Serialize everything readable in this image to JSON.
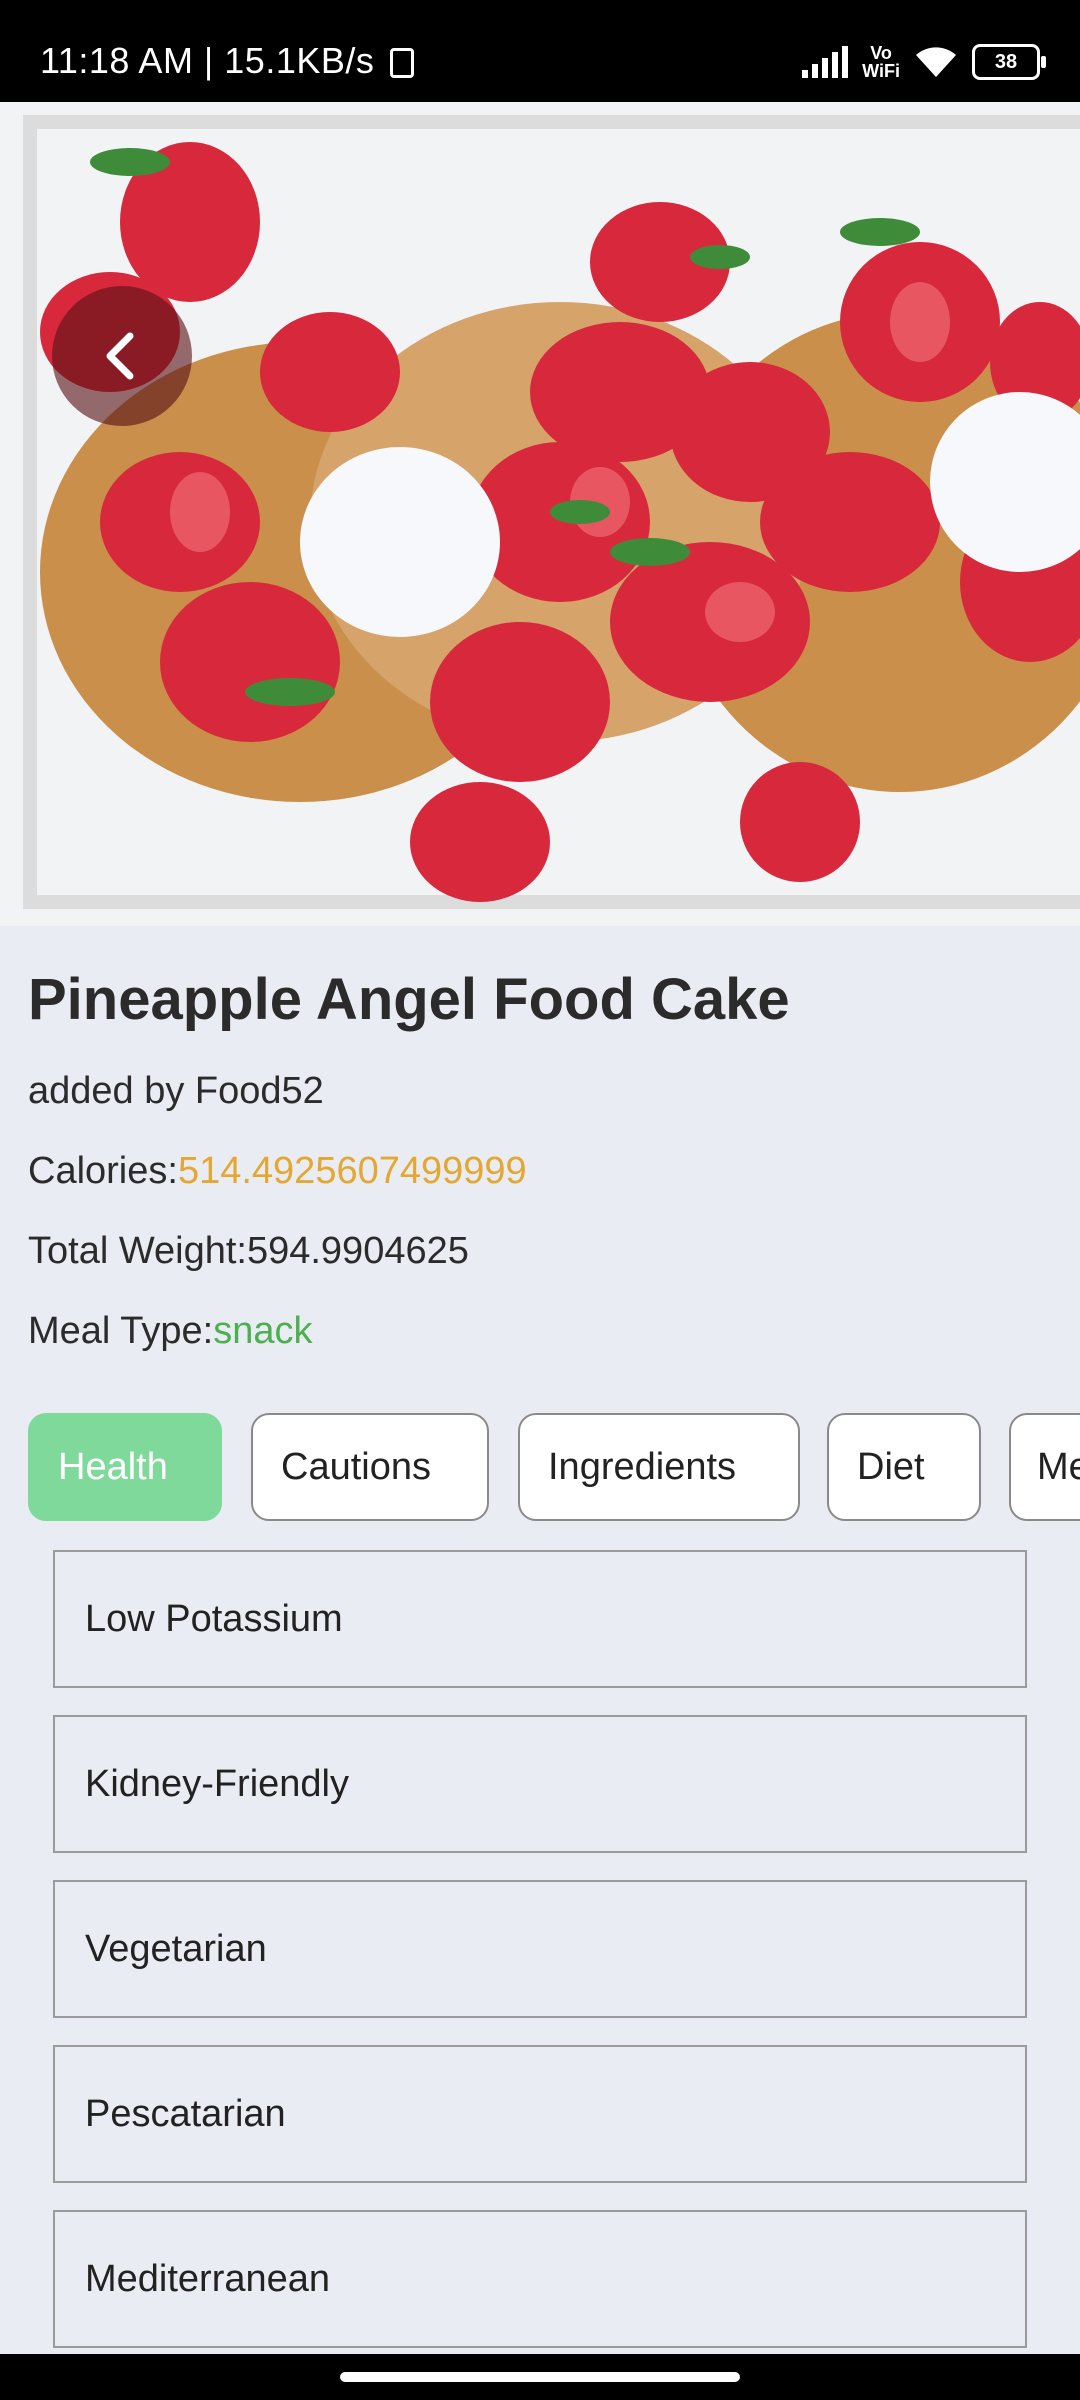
{
  "status_bar": {
    "time_speed": "11:18 AM | 15.1KB/s",
    "vowifi": "Vo\nWiFi",
    "battery": "38"
  },
  "hero": {
    "image_description": "",
    "back_icon": "chevron-left-icon"
  },
  "recipe": {
    "title": "Pineapple Angel Food Cake",
    "author": "added by Food52",
    "calories_label": "Calories:",
    "calories_value": "514.4925607499999",
    "weight_label": "Total Weight:",
    "weight_value": "594.9904625",
    "meal_label": "Meal Type:",
    "meal_value": "snack"
  },
  "tabs": [
    {
      "label": "Health",
      "active": true
    },
    {
      "label": "Cautions",
      "active": false
    },
    {
      "label": "Ingredients",
      "active": false
    },
    {
      "label": "Diet",
      "active": false
    },
    {
      "label": "Me",
      "active": false
    }
  ],
  "health_labels": [
    "Low Potassium",
    "Kidney-Friendly",
    "Vegetarian",
    "Pescatarian",
    "Mediterranean"
  ],
  "colors": {
    "accent_green": "#7fd99b",
    "calories_orange": "#e4a731",
    "meal_green": "#4caf50",
    "background": "#e9ecf3"
  }
}
